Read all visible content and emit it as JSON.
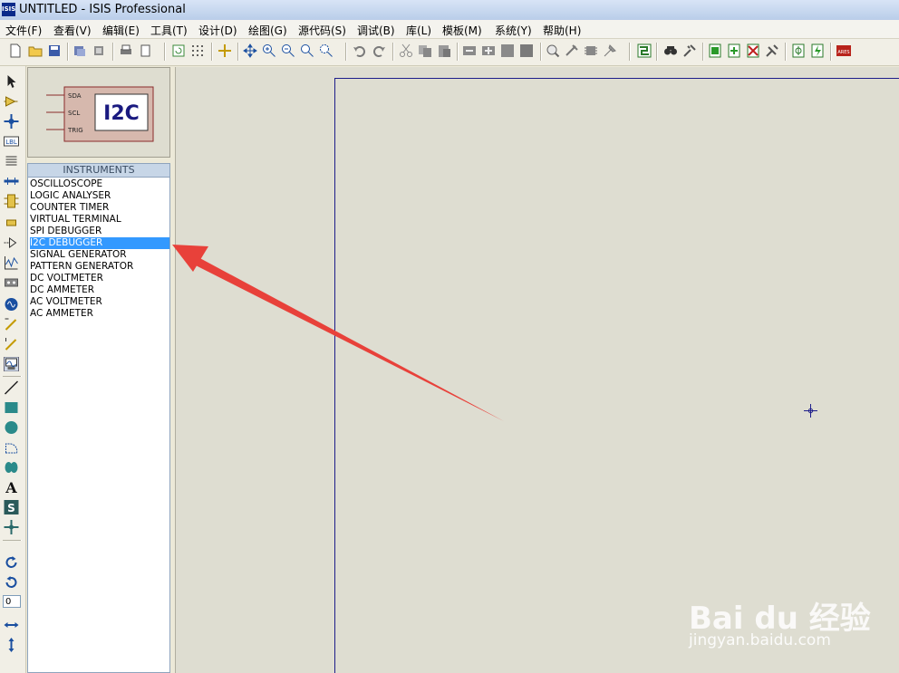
{
  "window": {
    "title": "UNTITLED - ISIS Professional",
    "app_icon_text": "ISIS"
  },
  "menu": [
    "文件(F)",
    "查看(V)",
    "编辑(E)",
    "工具(T)",
    "设计(D)",
    "绘图(G)",
    "源代码(S)",
    "调试(B)",
    "库(L)",
    "模板(M)",
    "系统(Y)",
    "帮助(H)"
  ],
  "preview": {
    "label": "I2C",
    "pins": [
      "SDA",
      "SCL",
      "TRIG"
    ]
  },
  "instruments": {
    "header": "INSTRUMENTS",
    "items": [
      "OSCILLOSCOPE",
      "LOGIC ANALYSER",
      "COUNTER TIMER",
      "VIRTUAL TERMINAL",
      "SPI DEBUGGER",
      "I2C DEBUGGER",
      "SIGNAL GENERATOR",
      "PATTERN GENERATOR",
      "DC VOLTMETER",
      "DC AMMETER",
      "AC VOLTMETER",
      "AC AMMETER"
    ],
    "selected": "I2C DEBUGGER"
  },
  "rotation_value": "0",
  "lefttool_text": {
    "lbl": "LBL"
  },
  "watermark": {
    "brand": "Bai du 经验",
    "url": "jingyan.baidu.com"
  },
  "colors": {
    "selection": "#3399ff",
    "arrow": "#e8413a",
    "sheet_border": "#1d1d8a",
    "canvas": "#deddd1"
  }
}
